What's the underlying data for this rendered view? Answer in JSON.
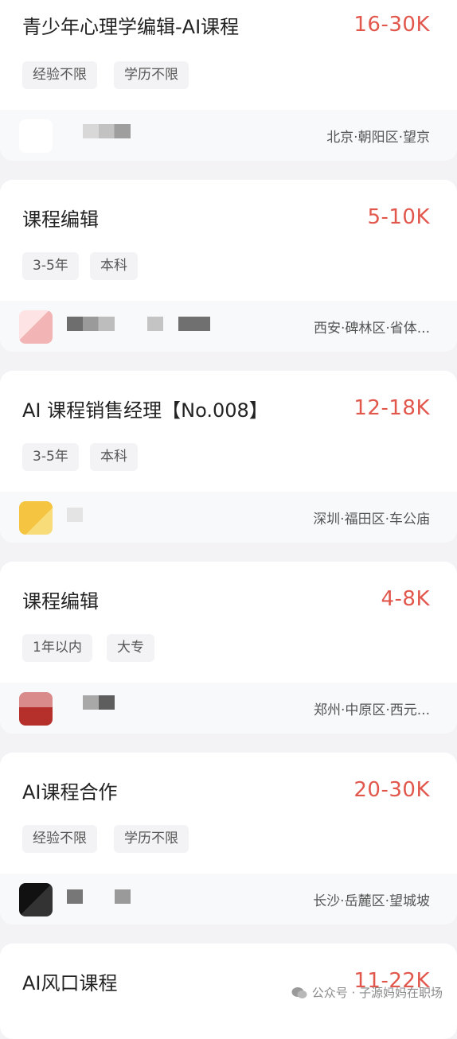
{
  "jobs": [
    {
      "title": "青少年心理学编辑-AI课程",
      "salary": "16-30K",
      "tags": [
        "经验不限",
        "学历不限"
      ],
      "location": "北京·朝阳区·望京"
    },
    {
      "title": "课程编辑",
      "salary": "5-10K",
      "tags": [
        "3-5年",
        "本科"
      ],
      "location": "西安·碑林区·省体..."
    },
    {
      "title": "AI 课程销售经理【No.008】",
      "salary": "12-18K",
      "tags": [
        "3-5年",
        "本科"
      ],
      "location": "深圳·福田区·车公庙"
    },
    {
      "title": "课程编辑",
      "salary": "4-8K",
      "tags": [
        "1年以内",
        "大专"
      ],
      "location": "郑州·中原区·西元..."
    },
    {
      "title": "AI课程合作",
      "salary": "20-30K",
      "tags": [
        "经验不限",
        "学历不限"
      ],
      "location": "长沙·岳麓区·望城坡"
    },
    {
      "title": "AI风口课程",
      "salary": "11-22K",
      "tags": [],
      "location": ""
    }
  ],
  "watermark": {
    "text": "公众号 · 子源妈妈在职场",
    "icon": "wechat-icon"
  },
  "colors": {
    "salary": "#e2574c",
    "title": "#222222",
    "tag_bg": "#f3f3f5",
    "page_bg": "#f3f3f5"
  }
}
